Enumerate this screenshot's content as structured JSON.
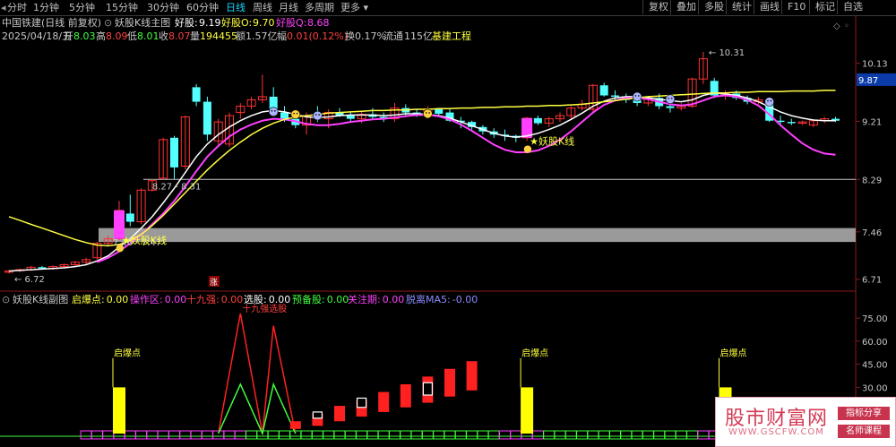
{
  "toolbar": {
    "timeframes": [
      {
        "label": "分时",
        "active": false
      },
      {
        "label": "1分钟",
        "active": false
      },
      {
        "label": "5分钟",
        "active": false
      },
      {
        "label": "15分钟",
        "active": false
      },
      {
        "label": "30分钟",
        "active": false
      },
      {
        "label": "60分钟",
        "active": false
      },
      {
        "label": "日线",
        "active": true
      },
      {
        "label": "周线",
        "active": false
      },
      {
        "label": "月线",
        "active": false
      },
      {
        "label": "多周期",
        "active": false
      },
      {
        "label": "更多",
        "active": false
      }
    ],
    "buttons": [
      "复权",
      "叠加",
      "多股",
      "统计",
      "画线",
      "F10",
      "标记",
      "自选"
    ],
    "add_watch": "+自选"
  },
  "header": {
    "title": "中国铁建(日线 前复权)",
    "indicator_name": "妖股K线主图",
    "hp_label": "好股:",
    "hp_value": "9.19",
    "hp_o_label": "好股O:",
    "hp_o_value": "9.70",
    "hp_q_label": "好股Q:",
    "hp_q_value": "8.68",
    "date": "2025/04/18/五",
    "open_label": "开",
    "open": "8.03",
    "high_label": "高",
    "high": "8.09",
    "low_label": "低",
    "low": "8.01",
    "close_label": "收",
    "close": "8.07",
    "vol_label": "量",
    "vol": "194455",
    "amt_label": "额",
    "amt": "1.57亿",
    "chg_label": "幅",
    "chg": "0.01(0.12%)",
    "turn_label": "换",
    "turn": "0.17%",
    "float_label": "流通",
    "float": "115亿",
    "sector": "基建工程"
  },
  "sub_header": {
    "name": "妖股K线副图",
    "items": [
      {
        "label": "启爆点:",
        "value": "0.00",
        "color": "#ffff40"
      },
      {
        "label": "操作区:",
        "value": "0.00",
        "color": "#ff40ff"
      },
      {
        "label": "十九强:",
        "value": "0.00",
        "color": "#ff4040"
      },
      {
        "label": "选股:",
        "value": "0.00",
        "color": "#ffffff"
      },
      {
        "label": "预备股:",
        "value": "0.00",
        "color": "#40ff40"
      },
      {
        "label": "关注期:",
        "value": "0.00",
        "color": "#ff40ff"
      },
      {
        "label": "脱离MA5:",
        "value": "-0.00",
        "color": "#8a8aff"
      }
    ]
  },
  "chart_data": [
    {
      "type": "candlestick",
      "title": "妖股K线主图",
      "y_axis_labels": [
        "10.13",
        "9.21",
        "8.29",
        "7.46",
        "6.71"
      ],
      "y_axis_values": [
        10.13,
        9.21,
        8.29,
        7.46,
        6.71
      ],
      "current_price_label": "9.87",
      "current_price": 9.87,
      "ylim": [
        6.55,
        10.45
      ],
      "annotations": [
        {
          "text": "10.31",
          "type": "high"
        },
        {
          "text": "6.72",
          "type": "low"
        },
        {
          "text": "8.27 - 8.31",
          "type": "gap"
        },
        {
          "text": "7.46 - 7.47",
          "type": "gap"
        },
        {
          "text": "妖股K线",
          "type": "signal",
          "index": 10
        },
        {
          "text": "妖股K线",
          "type": "signal",
          "index": 47
        },
        {
          "text": "涨",
          "type": "marker",
          "index": 20
        }
      ],
      "candles": [
        {
          "o": 6.82,
          "h": 6.86,
          "l": 6.8,
          "c": 6.84
        },
        {
          "o": 6.85,
          "h": 6.88,
          "l": 6.82,
          "c": 6.86
        },
        {
          "o": 6.86,
          "h": 6.92,
          "l": 6.84,
          "c": 6.9
        },
        {
          "o": 6.9,
          "h": 6.92,
          "l": 6.86,
          "c": 6.88
        },
        {
          "o": 6.88,
          "h": 6.93,
          "l": 6.86,
          "c": 6.91
        },
        {
          "o": 6.91,
          "h": 6.96,
          "l": 6.89,
          "c": 6.94
        },
        {
          "o": 6.94,
          "h": 7.0,
          "l": 6.92,
          "c": 6.98
        },
        {
          "o": 6.98,
          "h": 7.05,
          "l": 6.95,
          "c": 7.02
        },
        {
          "o": 7.05,
          "h": 7.3,
          "l": 7.02,
          "c": 7.28
        },
        {
          "o": 7.28,
          "h": 7.4,
          "l": 7.22,
          "c": 7.35
        },
        {
          "o": 7.35,
          "h": 7.95,
          "l": 7.33,
          "c": 7.8
        },
        {
          "o": 7.75,
          "h": 8.05,
          "l": 7.55,
          "c": 7.62
        },
        {
          "o": 7.62,
          "h": 8.15,
          "l": 7.58,
          "c": 8.12
        },
        {
          "o": 8.12,
          "h": 8.3,
          "l": 8.1,
          "c": 8.27
        },
        {
          "o": 8.31,
          "h": 8.95,
          "l": 8.28,
          "c": 8.92
        },
        {
          "o": 8.95,
          "h": 8.98,
          "l": 8.3,
          "c": 8.48
        },
        {
          "o": 8.5,
          "h": 9.3,
          "l": 8.45,
          "c": 9.28
        },
        {
          "o": 9.75,
          "h": 9.8,
          "l": 9.45,
          "c": 9.52
        },
        {
          "o": 9.52,
          "h": 9.6,
          "l": 8.9,
          "c": 9.0
        },
        {
          "o": 8.9,
          "h": 9.25,
          "l": 8.8,
          "c": 9.2
        },
        {
          "o": 8.85,
          "h": 9.35,
          "l": 8.8,
          "c": 9.3
        },
        {
          "o": 9.35,
          "h": 9.5,
          "l": 9.25,
          "c": 9.45
        },
        {
          "o": 9.45,
          "h": 9.6,
          "l": 9.4,
          "c": 9.55
        },
        {
          "o": 9.55,
          "h": 9.95,
          "l": 9.5,
          "c": 9.6
        },
        {
          "o": 9.6,
          "h": 9.75,
          "l": 9.3,
          "c": 9.35
        },
        {
          "o": 9.35,
          "h": 9.45,
          "l": 9.2,
          "c": 9.25
        },
        {
          "o": 9.25,
          "h": 9.3,
          "l": 9.1,
          "c": 9.15
        },
        {
          "o": 9.15,
          "h": 9.35,
          "l": 9.0,
          "c": 9.3
        },
        {
          "o": 9.3,
          "h": 9.45,
          "l": 9.2,
          "c": 9.25
        },
        {
          "o": 9.25,
          "h": 9.4,
          "l": 9.1,
          "c": 9.35
        },
        {
          "o": 9.35,
          "h": 9.42,
          "l": 9.28,
          "c": 9.3
        },
        {
          "o": 9.3,
          "h": 9.35,
          "l": 9.2,
          "c": 9.25
        },
        {
          "o": 9.25,
          "h": 9.38,
          "l": 9.18,
          "c": 9.32
        },
        {
          "o": 9.32,
          "h": 9.42,
          "l": 9.25,
          "c": 9.28
        },
        {
          "o": 9.28,
          "h": 9.35,
          "l": 9.2,
          "c": 9.25
        },
        {
          "o": 9.25,
          "h": 9.5,
          "l": 9.2,
          "c": 9.42
        },
        {
          "o": 9.42,
          "h": 9.48,
          "l": 9.3,
          "c": 9.35
        },
        {
          "o": 9.35,
          "h": 9.4,
          "l": 9.28,
          "c": 9.32
        },
        {
          "o": 9.32,
          "h": 9.45,
          "l": 9.25,
          "c": 9.4
        },
        {
          "o": 9.4,
          "h": 9.42,
          "l": 9.3,
          "c": 9.33
        },
        {
          "o": 9.35,
          "h": 9.4,
          "l": 9.2,
          "c": 9.22
        },
        {
          "o": 9.22,
          "h": 9.28,
          "l": 9.1,
          "c": 9.2
        },
        {
          "o": 9.2,
          "h": 9.22,
          "l": 9.08,
          "c": 9.12
        },
        {
          "o": 9.12,
          "h": 9.15,
          "l": 9.0,
          "c": 9.05
        },
        {
          "o": 9.05,
          "h": 9.1,
          "l": 8.95,
          "c": 9.0
        },
        {
          "o": 9.0,
          "h": 9.08,
          "l": 8.9,
          "c": 8.98
        },
        {
          "o": 8.98,
          "h": 9.0,
          "l": 8.88,
          "c": 8.95
        },
        {
          "o": 8.95,
          "h": 9.28,
          "l": 8.9,
          "c": 9.26
        },
        {
          "o": 9.26,
          "h": 9.3,
          "l": 9.15,
          "c": 9.18
        },
        {
          "o": 9.18,
          "h": 9.28,
          "l": 9.12,
          "c": 9.25
        },
        {
          "o": 9.25,
          "h": 9.35,
          "l": 9.2,
          "c": 9.3
        },
        {
          "o": 9.3,
          "h": 9.45,
          "l": 9.25,
          "c": 9.42
        },
        {
          "o": 9.42,
          "h": 9.55,
          "l": 9.38,
          "c": 9.48
        },
        {
          "o": 9.4,
          "h": 9.8,
          "l": 9.35,
          "c": 9.78
        },
        {
          "o": 9.78,
          "h": 9.82,
          "l": 9.6,
          "c": 9.62
        },
        {
          "o": 9.62,
          "h": 9.7,
          "l": 9.55,
          "c": 9.6
        },
        {
          "o": 9.6,
          "h": 9.65,
          "l": 9.5,
          "c": 9.55
        },
        {
          "o": 9.55,
          "h": 9.62,
          "l": 9.45,
          "c": 9.5
        },
        {
          "o": 9.5,
          "h": 9.6,
          "l": 9.45,
          "c": 9.58
        },
        {
          "o": 9.58,
          "h": 9.65,
          "l": 9.4,
          "c": 9.45
        },
        {
          "o": 9.45,
          "h": 9.55,
          "l": 9.35,
          "c": 9.42
        },
        {
          "o": 9.42,
          "h": 9.5,
          "l": 9.38,
          "c": 9.45
        },
        {
          "o": 9.45,
          "h": 9.9,
          "l": 9.42,
          "c": 9.88
        },
        {
          "o": 9.88,
          "h": 10.31,
          "l": 9.8,
          "c": 10.2
        },
        {
          "o": 9.85,
          "h": 9.9,
          "l": 9.58,
          "c": 9.62
        },
        {
          "o": 9.62,
          "h": 9.7,
          "l": 9.55,
          "c": 9.65
        },
        {
          "o": 9.65,
          "h": 9.7,
          "l": 9.55,
          "c": 9.58
        },
        {
          "o": 9.58,
          "h": 9.62,
          "l": 9.48,
          "c": 9.52
        },
        {
          "o": 9.52,
          "h": 9.6,
          "l": 9.48,
          "c": 9.55
        },
        {
          "o": 9.55,
          "h": 9.58,
          "l": 9.2,
          "c": 9.22
        },
        {
          "o": 9.22,
          "h": 9.3,
          "l": 9.15,
          "c": 9.2
        },
        {
          "o": 9.2,
          "h": 9.25,
          "l": 9.15,
          "c": 9.18
        },
        {
          "o": 9.18,
          "h": 9.22,
          "l": 9.15,
          "c": 9.2
        },
        {
          "o": 9.15,
          "h": 9.25,
          "l": 9.12,
          "c": 9.22
        },
        {
          "o": 9.22,
          "h": 9.28,
          "l": 9.18,
          "c": 9.25
        },
        {
          "o": 9.25,
          "h": 9.28,
          "l": 9.2,
          "c": 9.22
        }
      ],
      "series": [
        {
          "name": "",
          "color": "#ffffff",
          "values": [
            6.84,
            6.85,
            6.86,
            6.87,
            6.88,
            6.89,
            6.91,
            6.94,
            7.0,
            7.08,
            7.22,
            7.35,
            7.52,
            7.7,
            7.92,
            8.15,
            8.4,
            8.65,
            8.85,
            9.0,
            9.12,
            9.22,
            9.3,
            9.36,
            9.38,
            9.36,
            9.32,
            9.28,
            9.27,
            9.28,
            9.3,
            9.31,
            9.31,
            9.31,
            9.3,
            9.31,
            9.33,
            9.33,
            9.32,
            9.3,
            9.26,
            9.2,
            9.14,
            9.08,
            9.02,
            8.98,
            8.96,
            8.98,
            9.02,
            9.08,
            9.15,
            9.24,
            9.34,
            9.45,
            9.53,
            9.58,
            9.6,
            9.6,
            9.58,
            9.56,
            9.54,
            9.52,
            9.55,
            9.62,
            9.66,
            9.64,
            9.62,
            9.58,
            9.52,
            9.44,
            9.36,
            9.3,
            9.26,
            9.23,
            9.22,
            9.22
          ]
        },
        {
          "name": "",
          "color": "#ff40ff",
          "values": [
            null,
            null,
            null,
            null,
            null,
            null,
            null,
            null,
            6.98,
            7.05,
            7.15,
            7.28,
            7.42,
            7.58,
            7.75,
            7.95,
            8.18,
            8.42,
            8.65,
            8.82,
            8.97,
            9.08,
            9.16,
            9.22,
            9.25,
            9.24,
            9.21,
            9.17,
            9.15,
            9.15,
            9.17,
            9.2,
            9.22,
            9.24,
            9.25,
            9.27,
            9.29,
            9.31,
            9.31,
            9.29,
            9.24,
            9.16,
            9.06,
            8.95,
            8.84,
            8.76,
            8.72,
            8.72,
            8.75,
            8.82,
            8.92,
            9.05,
            9.2,
            9.35,
            9.47,
            9.54,
            9.58,
            9.58,
            9.56,
            9.52,
            9.48,
            9.46,
            9.48,
            9.54,
            9.6,
            9.62,
            9.6,
            9.55,
            9.46,
            9.32,
            9.15,
            9.0,
            8.86,
            8.76,
            8.7,
            8.68
          ]
        },
        {
          "name": "",
          "color": "#ffff40",
          "values": [
            7.7,
            7.64,
            7.58,
            7.52,
            7.46,
            7.4,
            7.34,
            7.29,
            7.25,
            7.24,
            7.26,
            7.32,
            7.42,
            7.56,
            7.72,
            7.9,
            8.08,
            8.26,
            8.44,
            8.6,
            8.75,
            8.88,
            9.0,
            9.1,
            9.18,
            9.24,
            9.28,
            9.3,
            9.32,
            9.34,
            9.35,
            9.36,
            9.37,
            9.38,
            9.38,
            9.39,
            9.39,
            9.4,
            9.4,
            9.41,
            9.41,
            9.42,
            9.42,
            9.43,
            9.43,
            9.44,
            9.44,
            9.45,
            9.45,
            9.46,
            9.46,
            9.47,
            9.48,
            9.5,
            9.52,
            9.54,
            9.56,
            9.58,
            9.6,
            9.61,
            9.62,
            9.63,
            9.64,
            9.65,
            9.66,
            9.66,
            9.67,
            9.67,
            9.68,
            9.68,
            9.68,
            9.69,
            9.69,
            9.69,
            9.7,
            9.7
          ]
        }
      ]
    },
    {
      "type": "bar",
      "title": "妖股K线副图",
      "y_axis_labels": [
        "75.00",
        "60.00",
        "45.00",
        "30.00"
      ],
      "y_axis_values": [
        75,
        60,
        45,
        30
      ],
      "ylim": [
        0,
        82
      ],
      "labels": [
        {
          "text": "启爆点",
          "index": 12
        },
        {
          "text": "启爆点",
          "index": 50
        },
        {
          "text": "启爆点",
          "index": 68
        }
      ],
      "qibaodian_indices": [
        10,
        47,
        65
      ],
      "zigzag_red": [
        {
          "index": 19,
          "v": 0
        },
        {
          "index": 21,
          "v": 78
        },
        {
          "index": 23,
          "v": 0
        },
        {
          "index": 24,
          "v": 70
        },
        {
          "index": 26,
          "v": 0
        }
      ],
      "zigzag_green": [
        {
          "index": 19,
          "v": 0
        },
        {
          "index": 21,
          "v": 32
        },
        {
          "index": 23,
          "v": 0
        },
        {
          "index": 24,
          "v": 32
        },
        {
          "index": 26,
          "v": 0
        }
      ],
      "zigzag_label": "十九强选股",
      "red_blocks": [
        {
          "index": 26,
          "lo": 3,
          "hi": 8
        },
        {
          "index": 28,
          "lo": 5,
          "hi": 13
        },
        {
          "index": 30,
          "lo": 8,
          "hi": 18
        },
        {
          "index": 32,
          "lo": 11,
          "hi": 22
        },
        {
          "index": 34,
          "lo": 14,
          "hi": 27
        },
        {
          "index": 36,
          "lo": 17,
          "hi": 32
        },
        {
          "index": 38,
          "lo": 20,
          "hi": 37
        },
        {
          "index": 40,
          "lo": 24,
          "hi": 42
        },
        {
          "index": 42,
          "lo": 28,
          "hi": 47
        }
      ],
      "hollow_blocks": [
        {
          "index": 28,
          "lo": 10,
          "hi": 14
        },
        {
          "index": 32,
          "lo": 17,
          "hi": 23
        },
        {
          "index": 38,
          "lo": 25,
          "hi": 33
        }
      ]
    }
  ],
  "watermark": {
    "title": "股市财富网",
    "url": "WWW.GSCFW.COM",
    "tag1": "指标分享",
    "tag2": "名师课程"
  }
}
